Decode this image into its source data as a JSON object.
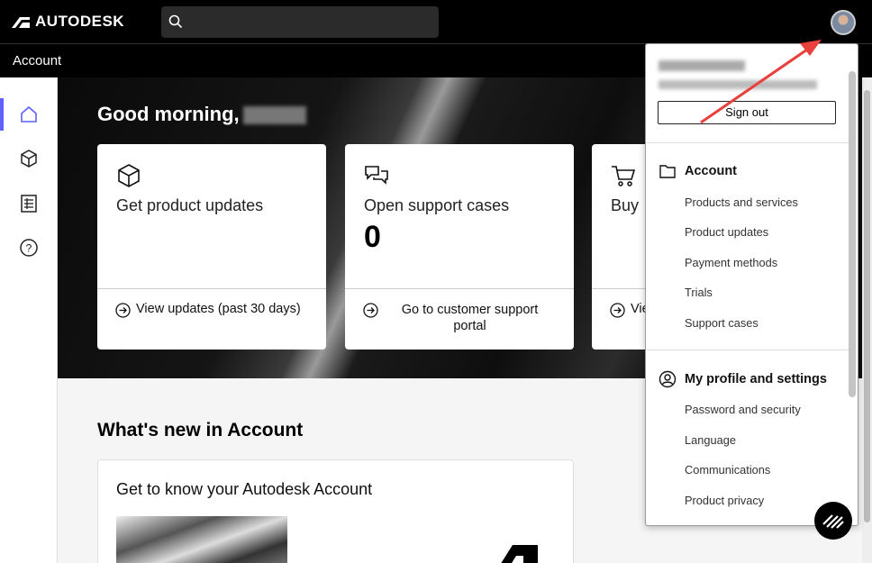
{
  "header": {
    "logo_text": "AUTODESK",
    "search_placeholder": "",
    "subbar_title": "Account"
  },
  "sidenav": {
    "items": [
      {
        "name": "home",
        "active": true
      },
      {
        "name": "products"
      },
      {
        "name": "billing"
      },
      {
        "name": "help"
      }
    ]
  },
  "hero": {
    "greeting": "Good morning,",
    "cards": [
      {
        "title": "Get product updates",
        "count": "",
        "link": "View updates (past 30 days)"
      },
      {
        "title": "Open support cases",
        "count": "0",
        "link": "Go to customer support portal"
      },
      {
        "title": "Buy",
        "count": "",
        "link": "Vie"
      }
    ]
  },
  "main": {
    "whats_new_title": "What's new in Account",
    "know_card_title": "Get to know your Autodesk Account"
  },
  "dropdown": {
    "signout_label": "Sign out",
    "account_section": {
      "title": "Account",
      "items": [
        "Products and services",
        "Product updates",
        "Payment methods",
        "Trials",
        "Support cases"
      ]
    },
    "profile_section": {
      "title": "My profile and settings",
      "items": [
        "Password and security",
        "Language",
        "Communications",
        "Product privacy"
      ]
    }
  },
  "colors": {
    "accent": "#5f60ff",
    "annotation_arrow": "#e8403a"
  }
}
